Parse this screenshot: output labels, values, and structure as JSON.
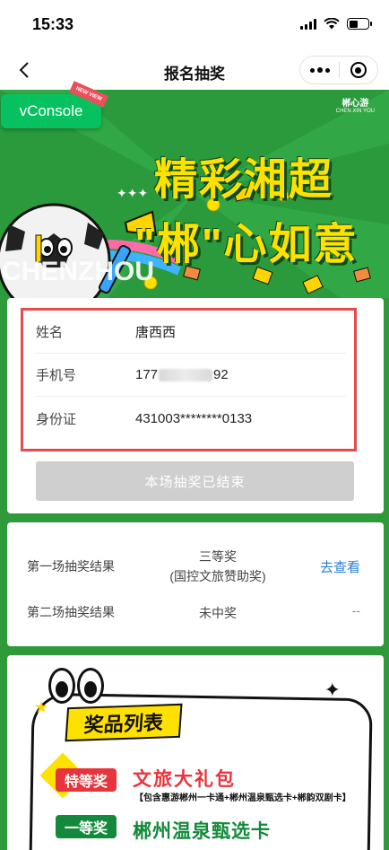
{
  "status_bar": {
    "time": "15:33"
  },
  "nav": {
    "title": "报名抽奖"
  },
  "banner": {
    "title_line1": "精彩湘超",
    "title_line2": "\"郴\"心如意",
    "city_text": "CHENZHOU",
    "logo_text": "郴心游",
    "logo_sub": "CHEN XIN YOU",
    "colors": {
      "background": "#2a9a3c",
      "title": "#ffe100"
    }
  },
  "vconsole": {
    "label": "vConsole",
    "ribbon": "NEW VIEW"
  },
  "info": {
    "rows": [
      {
        "label": "姓名",
        "value": "唐西西"
      },
      {
        "label": "手机号",
        "value_prefix": "177",
        "value_suffix": "92"
      },
      {
        "label": "身份证",
        "value": "431003********0133"
      }
    ],
    "button_label": "本场抽奖已结束"
  },
  "results": {
    "rows": [
      {
        "label": "第一场抽奖结果",
        "value_line1": "三等奖",
        "value_line2": "(国控文旅赞助奖)",
        "action": "去查看"
      },
      {
        "label": "第二场抽奖结果",
        "value_line1": "未中奖",
        "action": "--"
      }
    ]
  },
  "prizes": {
    "title": "奖品列表",
    "items": [
      {
        "tier": "特等奖",
        "name": "文旅大礼包",
        "desc": "【包含惠游郴州一卡通+郴州温泉甄选卡+郴韵双剧卡】"
      },
      {
        "tier": "一等奖",
        "name": "郴州温泉甄选卡"
      }
    ]
  }
}
